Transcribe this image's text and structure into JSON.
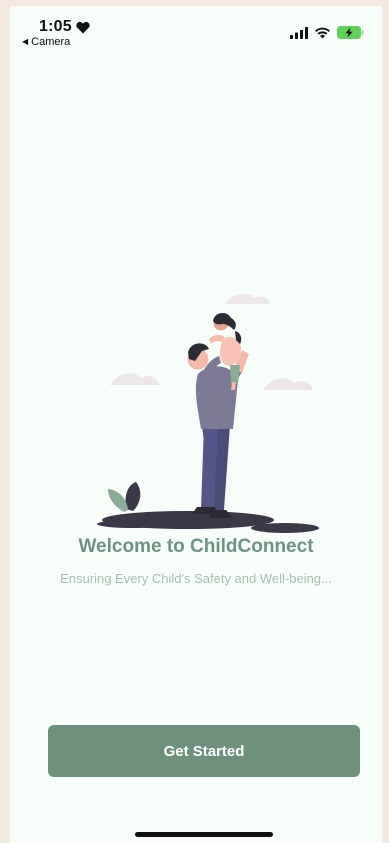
{
  "status_bar": {
    "time": "1:05",
    "back_app_label": "Camera",
    "icons": [
      "heart-icon",
      "signal-icon",
      "wifi-icon",
      "battery-icon"
    ]
  },
  "welcome": {
    "title": "Welcome to ChildConnect",
    "subtitle": "Ensuring Every Child's Safety and Well-being..."
  },
  "cta": {
    "label": "Get Started"
  },
  "colors": {
    "background": "#f7fdf8",
    "frame": "#f4e8e0",
    "accent": "#6e917c",
    "title": "#6e9480",
    "subtitle": "#a8bdb2"
  }
}
